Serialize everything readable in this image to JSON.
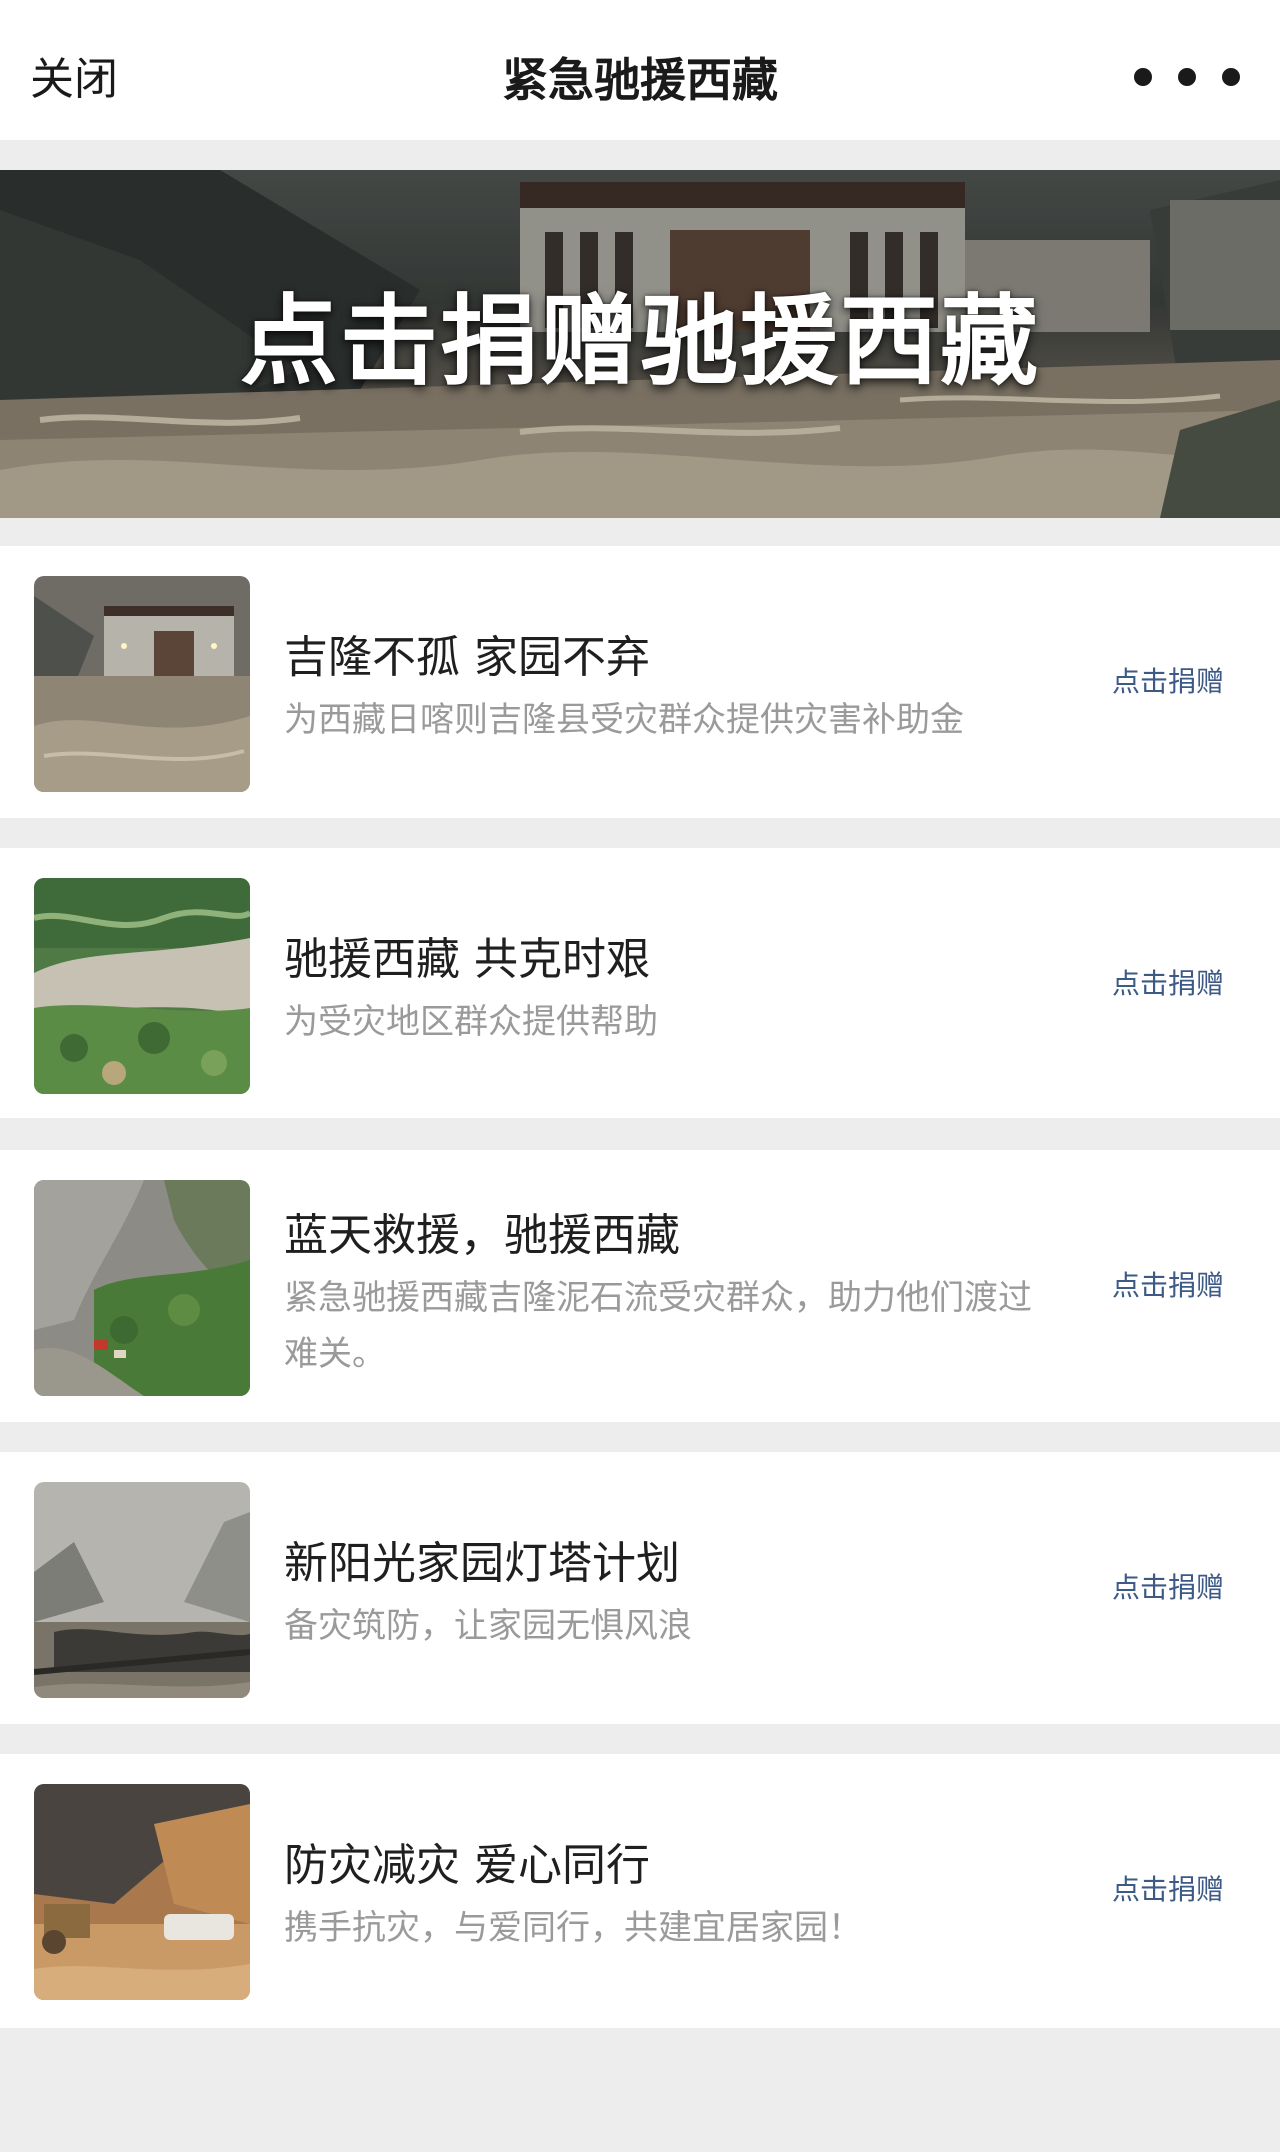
{
  "nav": {
    "close_label": "关闭",
    "title": "紧急驰援西藏",
    "more_icon": "more-dots-icon"
  },
  "banner": {
    "text": "点击捐赠驰援西藏"
  },
  "items": [
    {
      "title": "吉隆不孤 家园不弃",
      "description": "为西藏日喀则吉隆县受灾群众提供灾害补助金",
      "action": "点击捐赠"
    },
    {
      "title": "驰援西藏 共克时艰",
      "description": "为受灾地区群众提供帮助",
      "action": "点击捐赠"
    },
    {
      "title": "蓝天救援，驰援西藏",
      "description": "紧急驰援西藏吉隆泥石流受灾群众，助力他们渡过难关。",
      "action": "点击捐赠"
    },
    {
      "title": "新阳光家园灯塔计划",
      "description": "备灾筑防，让家园无惧风浪",
      "action": "点击捐赠"
    },
    {
      "title": "防灾减灾 爱心同行",
      "description": "携手抗灾，与爱同行，共建宜居家园！",
      "action": "点击捐赠"
    }
  ],
  "colors": {
    "background": "#ededed",
    "card": "#ffffff",
    "link": "#3d5a86",
    "subtext": "#9a9a9a"
  }
}
